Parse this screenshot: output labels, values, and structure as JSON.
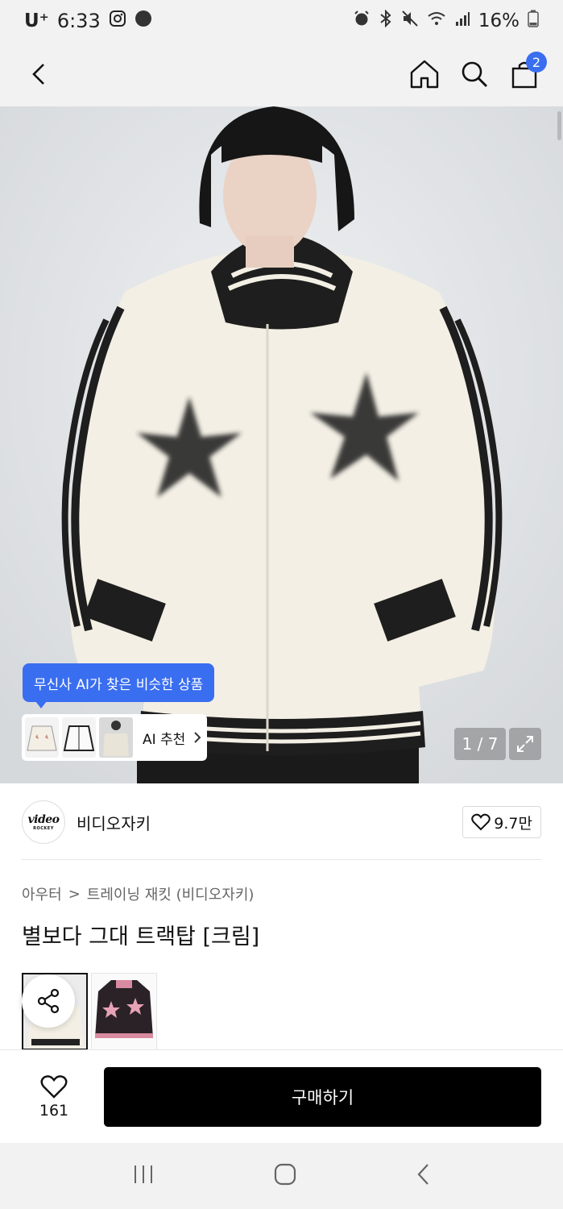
{
  "status": {
    "carrier": "U⁺",
    "time": "6:33",
    "battery": "16%"
  },
  "header": {
    "cart_count": "2"
  },
  "gallery": {
    "ai_tooltip": "무신사 AI가 찾은 비슷한 상품",
    "ai_recommend_label": "AI 추천",
    "page_indicator": "1 / 7"
  },
  "brand": {
    "logo_main": "video",
    "logo_sub": "ROCKEY",
    "name": "비디오자키",
    "likes": "9.7만"
  },
  "breadcrumb": {
    "category": "아우터",
    "separator": ">",
    "subcategory": "트레이닝 재킷 (비디오자키)"
  },
  "product": {
    "title": "별보다 그대 트랙탑 [크림]"
  },
  "bottom": {
    "wish_count": "161",
    "buy_label": "구매하기"
  },
  "colors": {
    "accent": "#3a6ef0",
    "buy_button": "#000000"
  }
}
